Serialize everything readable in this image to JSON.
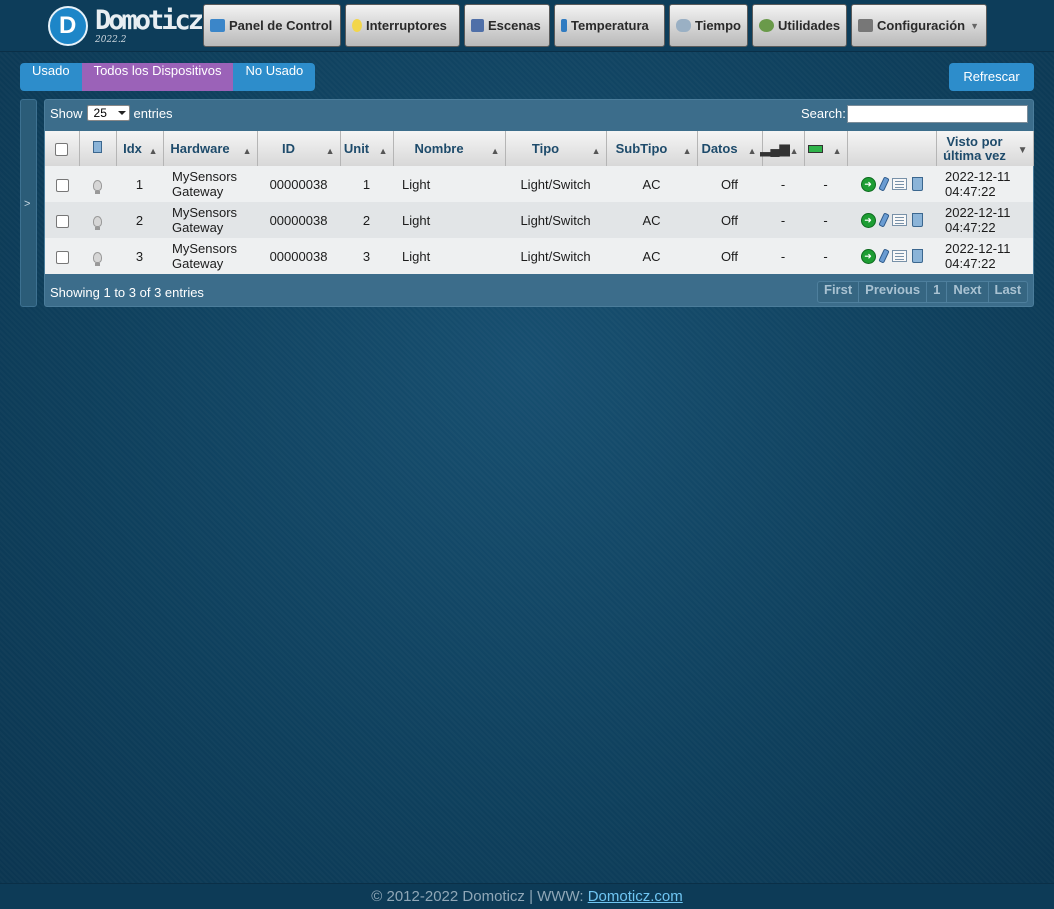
{
  "app": {
    "logo_text": "Domoticz",
    "version": "2022.2"
  },
  "nav": [
    {
      "label": "Panel de Control",
      "icon": "dashboard-icon"
    },
    {
      "label": "Interruptores",
      "icon": "lightbulb-icon"
    },
    {
      "label": "Escenas",
      "icon": "clapperboard-icon"
    },
    {
      "label": "Temperatura",
      "icon": "thermometer-icon"
    },
    {
      "label": "Tiempo",
      "icon": "weather-icon"
    },
    {
      "label": "Utilidades",
      "icon": "utility-icon"
    },
    {
      "label": "Configuración",
      "icon": "tools-icon",
      "dropdown": true
    }
  ],
  "filters": {
    "used": "Usado",
    "all": "Todos los Dispositivos",
    "unused": "No Usado",
    "active": "all",
    "refresh": "Refrescar"
  },
  "table_controls": {
    "show_label": "Show",
    "entries_label": "entries",
    "page_size": "25",
    "search_label": "Search:",
    "search_value": ""
  },
  "columns": [
    "",
    "",
    "Idx",
    "Hardware",
    "ID",
    "Unit",
    "Nombre",
    "Tipo",
    "SubTipo",
    "Datos",
    "",
    "",
    "",
    "Visto por última vez"
  ],
  "rows": [
    {
      "idx": "1",
      "hardware": "MySensors Gateway",
      "id": "00000038",
      "unit": "1",
      "name": "Light",
      "type": "Light/Switch",
      "subtype": "AC",
      "data": "Off",
      "signal": "-",
      "battery": "-",
      "last_seen": "2022-12-11 04:47:22"
    },
    {
      "idx": "2",
      "hardware": "MySensors Gateway",
      "id": "00000038",
      "unit": "2",
      "name": "Light",
      "type": "Light/Switch",
      "subtype": "AC",
      "data": "Off",
      "signal": "-",
      "battery": "-",
      "last_seen": "2022-12-11 04:47:22"
    },
    {
      "idx": "3",
      "hardware": "MySensors Gateway",
      "id": "00000038",
      "unit": "3",
      "name": "Light",
      "type": "Light/Switch",
      "subtype": "AC",
      "data": "Off",
      "signal": "-",
      "battery": "-",
      "last_seen": "2022-12-11 04:47:22"
    }
  ],
  "table_info": "Showing 1 to 3 of 3 entries",
  "pagination": {
    "first": "First",
    "previous": "Previous",
    "current": "1",
    "next": "Next",
    "last": "Last"
  },
  "footer": {
    "text": "© 2012-2022 Domoticz | WWW: ",
    "link": "Domoticz.com"
  },
  "colors": {
    "background": "#0e3f5c",
    "accent": "#2d8dcb",
    "active_filter": "#9b62b8"
  }
}
